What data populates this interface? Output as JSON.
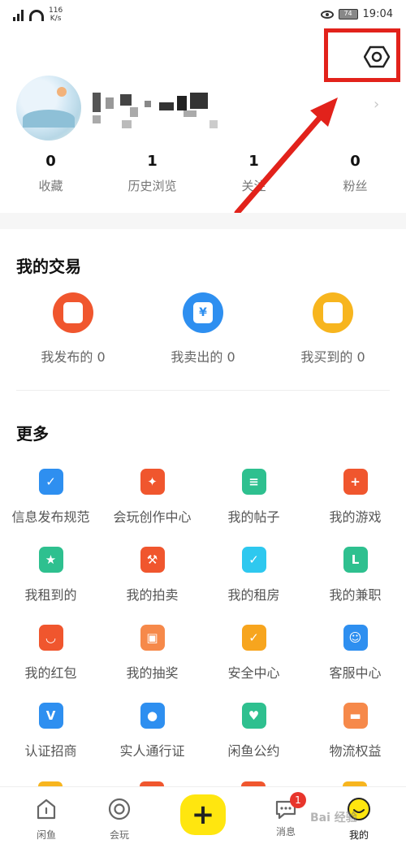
{
  "status_bar": {
    "net_speed_value": "116",
    "net_speed_unit": "K/s",
    "battery": "74",
    "time": "19:04"
  },
  "settings": {
    "icon": "hexagon-settings-icon",
    "highlight_color": "#e2221b"
  },
  "profile": {
    "stats": [
      {
        "value": "0",
        "label": "收藏"
      },
      {
        "value": "1",
        "label": "历史浏览"
      },
      {
        "value": "1",
        "label": "关注"
      },
      {
        "value": "0",
        "label": "粉丝"
      }
    ]
  },
  "my_trades": {
    "title": "我的交易",
    "items": [
      {
        "label": "我发布的 0",
        "color": "#f0562e",
        "glyph": ""
      },
      {
        "label": "我卖出的 0",
        "color": "#2e8ff0",
        "glyph": "¥"
      },
      {
        "label": "我买到的 0",
        "color": "#f7b51e",
        "glyph": ""
      }
    ]
  },
  "more": {
    "title": "更多",
    "items": [
      {
        "label": "信息发布规范",
        "color": "#2e8ff0",
        "glyph": "✓",
        "icon": "check-doc-icon"
      },
      {
        "label": "会玩创作中心",
        "color": "#f0562e",
        "glyph": "✦",
        "icon": "lightbulb-icon"
      },
      {
        "label": "我的帖子",
        "color": "#2ec08f",
        "glyph": "≡",
        "icon": "post-icon"
      },
      {
        "label": "我的游戏",
        "color": "#f0562e",
        "glyph": "+",
        "icon": "gamepad-icon"
      },
      {
        "label": "我租到的",
        "color": "#2ec08f",
        "glyph": "★",
        "icon": "rented-icon"
      },
      {
        "label": "我的拍卖",
        "color": "#f0562e",
        "glyph": "⚒",
        "icon": "auction-hammer-icon"
      },
      {
        "label": "我的租房",
        "color": "#2ec8ef",
        "glyph": "✓",
        "icon": "house-icon"
      },
      {
        "label": "我的兼职",
        "color": "#2ec08f",
        "glyph": "L",
        "icon": "clock-bag-icon"
      },
      {
        "label": "我的红包",
        "color": "#f0562e",
        "glyph": "◡",
        "icon": "red-packet-icon"
      },
      {
        "label": "我的抽奖",
        "color": "#f6894a",
        "glyph": "▣",
        "icon": "gift-icon"
      },
      {
        "label": "安全中心",
        "color": "#f7a51e",
        "glyph": "✓",
        "icon": "shield-icon"
      },
      {
        "label": "客服中心",
        "color": "#2e8ff0",
        "glyph": "☺",
        "icon": "headset-icon"
      },
      {
        "label": "认证招商",
        "color": "#2e8ff0",
        "glyph": "V",
        "icon": "verify-icon"
      },
      {
        "label": "实人通行证",
        "color": "#2e8ff0",
        "glyph": "●",
        "icon": "person-id-icon"
      },
      {
        "label": "闲鱼公约",
        "color": "#2ec08f",
        "glyph": "♥",
        "icon": "pact-icon"
      },
      {
        "label": "物流权益",
        "color": "#f6894a",
        "glyph": "▬",
        "icon": "logistics-box-icon"
      }
    ]
  },
  "tabbar": {
    "items": [
      {
        "label": "闲鱼",
        "icon": "home-icon"
      },
      {
        "label": "会玩",
        "icon": "circle-target-icon"
      },
      {
        "label": "消息",
        "icon": "chat-bubble-icon",
        "badge": "1"
      },
      {
        "label": "我的",
        "icon": "profile-face-icon"
      }
    ],
    "publish": {
      "label": "+",
      "color": "#ffe60f"
    }
  },
  "watermark": "Bai 经验"
}
